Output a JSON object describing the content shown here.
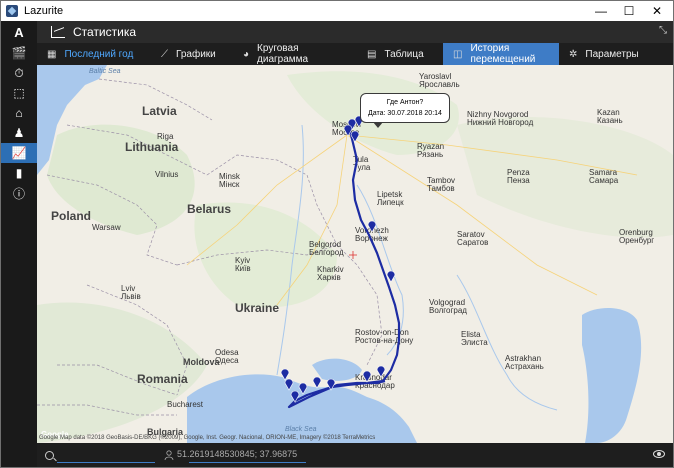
{
  "window": {
    "title": "Lazurite",
    "minimize": "—",
    "maximize": "☐",
    "close": "✕"
  },
  "header": {
    "title": "Статистика",
    "collapse": "⤡"
  },
  "tabs": [
    {
      "label": "Последний год",
      "icon": "calendar-icon"
    },
    {
      "label": "Графики",
      "icon": "chart-line-icon"
    },
    {
      "label": "Круговая диаграмма",
      "icon": "pie-chart-icon"
    },
    {
      "label": "Таблица",
      "icon": "table-icon"
    },
    {
      "label": "История перемещений",
      "icon": "map-route-icon",
      "active": true
    },
    {
      "label": "Параметры",
      "icon": "gear-icon"
    }
  ],
  "sidebar": {
    "logo": "A",
    "items": [
      {
        "icon": "clapperboard-icon",
        "glyph": "🎬"
      },
      {
        "icon": "timer-icon",
        "glyph": "⏱"
      },
      {
        "icon": "box-icon",
        "glyph": "⬚"
      },
      {
        "icon": "house-icon",
        "glyph": "⌂"
      },
      {
        "icon": "users-icon",
        "glyph": "♟"
      },
      {
        "icon": "statistics-icon",
        "glyph": "📈",
        "active": true
      },
      {
        "icon": "book-icon",
        "glyph": "▮"
      },
      {
        "icon": "info-icon",
        "glyph": "ⓘ"
      }
    ]
  },
  "map": {
    "tooltip": {
      "line1": "Где Антон?",
      "line2": "Дата: 30.07.2018 20:14"
    },
    "attribution": "Google   Map data ©2018 GeoBasis-DE/BKG (©2009), Google, Inst. Geogr. Nacional, ORION-ME, Imagery ©2018 TerraMetrics",
    "countries": [
      "Latvia",
      "Lithuania",
      "Belarus",
      "Poland",
      "Ukraine",
      "Moldova",
      "Romania",
      "Bulgaria"
    ],
    "seas": [
      "Baltic Sea",
      "Black Sea"
    ],
    "cities": [
      {
        "en": "Riga",
        "ru": ""
      },
      {
        "en": "Vilnius",
        "ru": ""
      },
      {
        "en": "Minsk",
        "ru": "Мінск"
      },
      {
        "en": "Warsaw",
        "ru": ""
      },
      {
        "en": "Kyiv",
        "ru": "Київ"
      },
      {
        "en": "Kharkiv",
        "ru": "Харків"
      },
      {
        "en": "Lviv",
        "ru": "Львів"
      },
      {
        "en": "Moscow",
        "ru": "Москва"
      },
      {
        "en": "Yaroslavl",
        "ru": "Ярославль"
      },
      {
        "en": "Voronezh",
        "ru": "Воронеж"
      },
      {
        "en": "Saratov",
        "ru": "Саратов"
      },
      {
        "en": "Volgograd",
        "ru": "Волгоград"
      },
      {
        "en": "Rostov-on-Don",
        "ru": "Ростов-на-Дону"
      },
      {
        "en": "Krasnodar",
        "ru": "Краснодар"
      },
      {
        "en": "Samara",
        "ru": "Самара"
      },
      {
        "en": "Kazan",
        "ru": "Казань"
      },
      {
        "en": "Nizhny Novgorod",
        "ru": "Нижний Новгород"
      },
      {
        "en": "Bucharest",
        "ru": ""
      },
      {
        "en": "Odesa",
        "ru": "Одеса"
      },
      {
        "en": "Penza",
        "ru": "Пенза"
      },
      {
        "en": "Tambov",
        "ru": "Тамбов"
      },
      {
        "en": "Ryazan",
        "ru": "Рязань"
      },
      {
        "en": "Tula",
        "ru": "Тула"
      },
      {
        "en": "Lipetsk",
        "ru": "Липецк"
      },
      {
        "en": "Belgorod",
        "ru": "Белгород"
      },
      {
        "en": "Orenburg",
        "ru": "Оренбург"
      },
      {
        "en": "Astrakhan",
        "ru": "Астрахань"
      },
      {
        "en": "Elista",
        "ru": "Элиста"
      }
    ]
  },
  "bottombar": {
    "coordinates": "51.2619148530845; 37.96875"
  }
}
